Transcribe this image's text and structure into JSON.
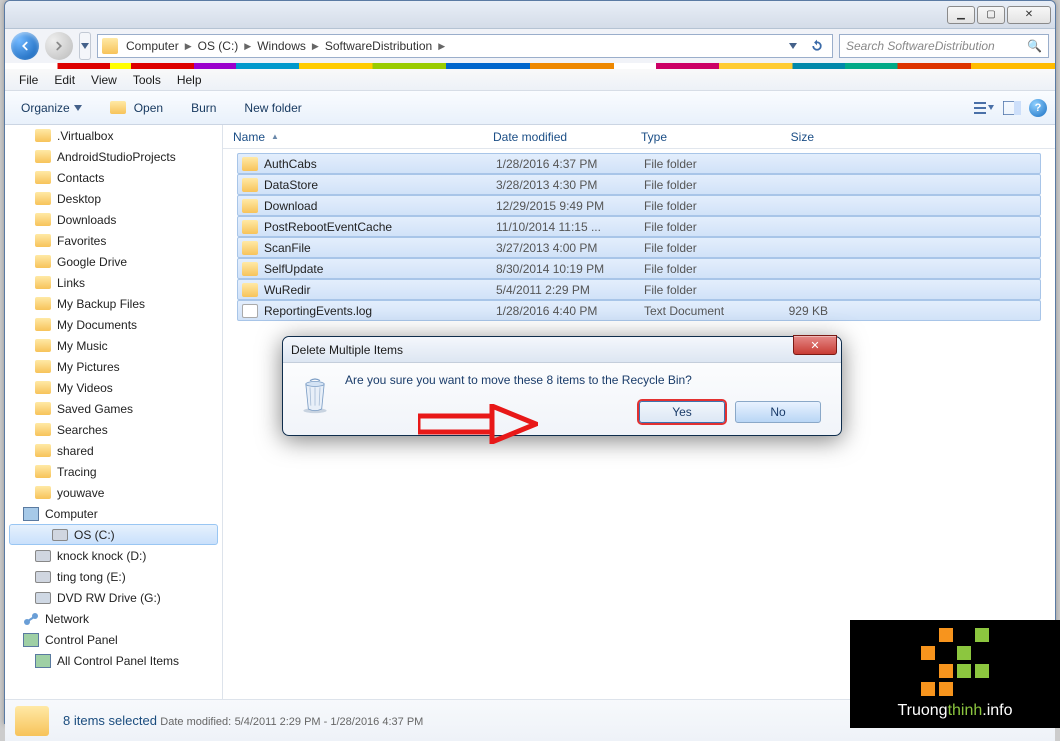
{
  "titlebar": {
    "min": "▁",
    "max": "▢",
    "close": "✕"
  },
  "nav": {
    "breadcrumb": [
      {
        "label": "Computer"
      },
      {
        "label": "OS (C:)"
      },
      {
        "label": "Windows"
      },
      {
        "label": "SoftwareDistribution"
      }
    ],
    "search_placeholder": "Search SoftwareDistribution"
  },
  "menu": {
    "file": "File",
    "edit": "Edit",
    "view": "View",
    "tools": "Tools",
    "help": "Help"
  },
  "toolbar": {
    "organize": "Organize",
    "open": "Open",
    "burn": "Burn",
    "newfolder": "New folder"
  },
  "sidebar": {
    "items": [
      {
        "label": ".Virtualbox",
        "type": "folder",
        "lvl": 1
      },
      {
        "label": "AndroidStudioProjects",
        "type": "folder",
        "lvl": 1
      },
      {
        "label": "Contacts",
        "type": "folder",
        "lvl": 1
      },
      {
        "label": "Desktop",
        "type": "folder",
        "lvl": 1
      },
      {
        "label": "Downloads",
        "type": "folder",
        "lvl": 1
      },
      {
        "label": "Favorites",
        "type": "folder",
        "lvl": 1
      },
      {
        "label": "Google Drive",
        "type": "folder",
        "lvl": 1
      },
      {
        "label": "Links",
        "type": "folder",
        "lvl": 1
      },
      {
        "label": "My Backup Files",
        "type": "folder",
        "lvl": 1
      },
      {
        "label": "My Documents",
        "type": "folder",
        "lvl": 1
      },
      {
        "label": "My Music",
        "type": "folder",
        "lvl": 1
      },
      {
        "label": "My Pictures",
        "type": "folder",
        "lvl": 1
      },
      {
        "label": "My Videos",
        "type": "folder",
        "lvl": 1
      },
      {
        "label": "Saved Games",
        "type": "folder",
        "lvl": 1
      },
      {
        "label": "Searches",
        "type": "folder",
        "lvl": 1
      },
      {
        "label": "shared",
        "type": "folder",
        "lvl": 1
      },
      {
        "label": "Tracing",
        "type": "folder",
        "lvl": 1
      },
      {
        "label": "youwave",
        "type": "folder",
        "lvl": 1
      },
      {
        "label": "Computer",
        "type": "computer",
        "lvl": 0
      },
      {
        "label": "OS (C:)",
        "type": "drive",
        "lvl": 1,
        "selected": true
      },
      {
        "label": "knock knock (D:)",
        "type": "drive",
        "lvl": 1
      },
      {
        "label": "ting tong (E:)",
        "type": "drive",
        "lvl": 1
      },
      {
        "label": "DVD RW Drive (G:)",
        "type": "dvd",
        "lvl": 1
      },
      {
        "label": "Network",
        "type": "network",
        "lvl": 0
      },
      {
        "label": "Control Panel",
        "type": "cpanel",
        "lvl": 0
      },
      {
        "label": "All Control Panel Items",
        "type": "cpanel",
        "lvl": 1
      }
    ]
  },
  "columns": {
    "name": "Name",
    "date": "Date modified",
    "type": "Type",
    "size": "Size"
  },
  "files": [
    {
      "name": "AuthCabs",
      "date": "1/28/2016 4:37 PM",
      "type": "File folder",
      "size": "",
      "icon": "folder"
    },
    {
      "name": "DataStore",
      "date": "3/28/2013 4:30 PM",
      "type": "File folder",
      "size": "",
      "icon": "folder"
    },
    {
      "name": "Download",
      "date": "12/29/2015 9:49 PM",
      "type": "File folder",
      "size": "",
      "icon": "folder"
    },
    {
      "name": "PostRebootEventCache",
      "date": "11/10/2014 11:15 ...",
      "type": "File folder",
      "size": "",
      "icon": "folder"
    },
    {
      "name": "ScanFile",
      "date": "3/27/2013 4:00 PM",
      "type": "File folder",
      "size": "",
      "icon": "folder"
    },
    {
      "name": "SelfUpdate",
      "date": "8/30/2014 10:19 PM",
      "type": "File folder",
      "size": "",
      "icon": "folder"
    },
    {
      "name": "WuRedir",
      "date": "5/4/2011 2:29 PM",
      "type": "File folder",
      "size": "",
      "icon": "folder"
    },
    {
      "name": "ReportingEvents.log",
      "date": "1/28/2016 4:40 PM",
      "type": "Text Document",
      "size": "929 KB",
      "icon": "doc"
    }
  ],
  "status": {
    "main": "8 items selected",
    "sublabel": "Date modified:",
    "subvalue": "5/4/2011 2:29 PM - 1/28/2016 4:37 PM"
  },
  "dialog": {
    "title": "Delete Multiple Items",
    "message": "Are you sure you want to move these 8 items to the Recycle Bin?",
    "yes": "Yes",
    "no": "No"
  },
  "logo": {
    "text1": "Truong",
    "text2": "thinh",
    "text3": ".info"
  }
}
